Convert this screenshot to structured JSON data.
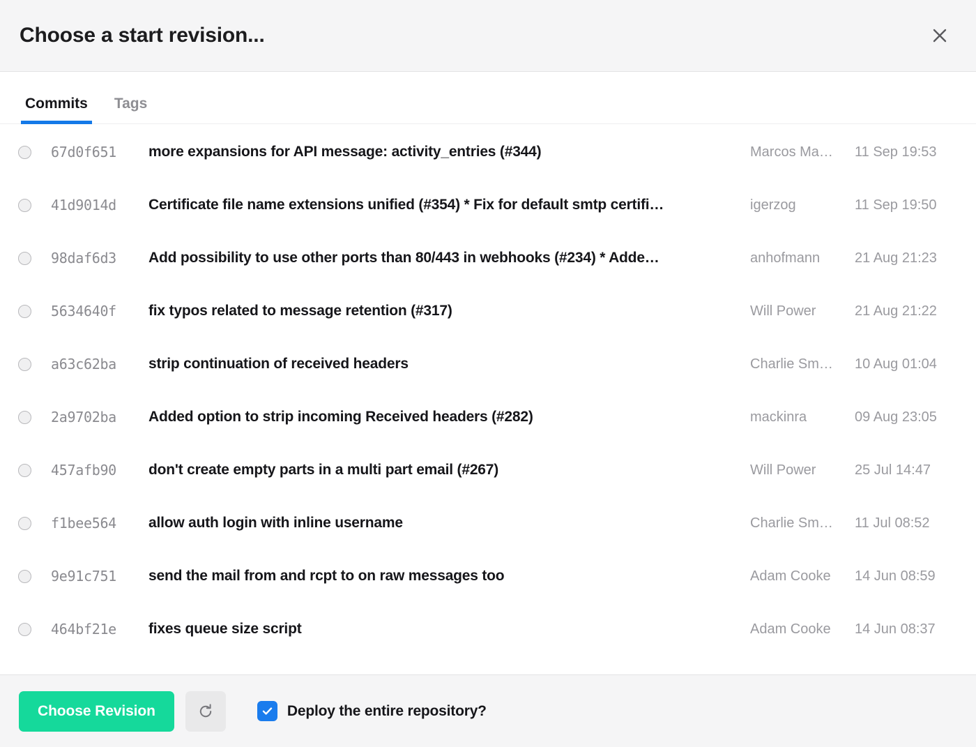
{
  "header": {
    "title": "Choose a start revision...",
    "close_icon": "close-icon"
  },
  "tabs": [
    {
      "label": "Commits",
      "active": true
    },
    {
      "label": "Tags",
      "active": false
    }
  ],
  "columns": {
    "select": "",
    "hash": "",
    "message": "",
    "author": "",
    "date": ""
  },
  "commits": [
    {
      "hash": "67d0f651",
      "message": "more expansions for API message: activity_entries (#344)",
      "author": "Marcos Ma…",
      "date": "11 Sep 19:53",
      "selected": false
    },
    {
      "hash": "41d9014d",
      "message": "Certificate file name extensions unified (#354) * Fix for default smtp certifi…",
      "author": "igerzog",
      "date": "11 Sep 19:50",
      "selected": false
    },
    {
      "hash": "98daf6d3",
      "message": "Add possibility to use other ports than 80/443 in webhooks (#234) * Adde…",
      "author": "anhofmann",
      "date": "21 Aug 21:23",
      "selected": false
    },
    {
      "hash": "5634640f",
      "message": "fix typos related to message retention (#317)",
      "author": "Will Power",
      "date": "21 Aug 21:22",
      "selected": false
    },
    {
      "hash": "a63c62ba",
      "message": "strip continuation of received headers",
      "author": "Charlie Sm…",
      "date": "10 Aug 01:04",
      "selected": false
    },
    {
      "hash": "2a9702ba",
      "message": "Added option to strip incoming Received headers (#282)",
      "author": "mackinra",
      "date": "09 Aug 23:05",
      "selected": false
    },
    {
      "hash": "457afb90",
      "message": "don't create empty parts in a multi part email (#267)",
      "author": "Will Power",
      "date": "25 Jul 14:47",
      "selected": false
    },
    {
      "hash": "f1bee564",
      "message": "allow auth login with inline username",
      "author": "Charlie Sm…",
      "date": "11 Jul 08:52",
      "selected": false
    },
    {
      "hash": "9e91c751",
      "message": "send the mail from and rcpt to on raw messages too",
      "author": "Adam Cooke",
      "date": "14 Jun 08:59",
      "selected": false
    },
    {
      "hash": "464bf21e",
      "message": "fixes queue size script",
      "author": "Adam Cooke",
      "date": "14 Jun 08:37",
      "selected": false
    }
  ],
  "footer": {
    "choose_revision_label": "Choose Revision",
    "refresh_icon": "refresh-icon",
    "deploy_checkbox": {
      "label": "Deploy the entire repository?",
      "checked": true
    }
  },
  "colors": {
    "accent_green": "#15d99b",
    "accent_blue": "#1479e8",
    "checkbox_blue": "#1a7ced",
    "header_bg": "#f5f5f6",
    "text_primary": "#16161a",
    "text_muted": "#9a9a9f"
  }
}
